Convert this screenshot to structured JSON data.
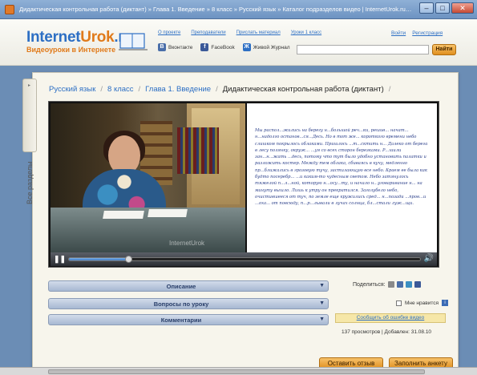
{
  "browser": {
    "title": "Дидактическая контрольная работа (диктант) » Глава 1. Введение » 8 класс » Русский язык » Каталог подразделов видео | InternetUrok.ru - видеоуроки по физике, математике..."
  },
  "header": {
    "logo_main_a": "Internet",
    "logo_main_b": "Urok",
    "logo_main_c": ".ru",
    "logo_sub": "Видеоуроки в Интернете",
    "nav": [
      "О проекте",
      "Преподаватели",
      "Прислать материал",
      "Уроки 1 класс"
    ],
    "social": [
      {
        "label": "Вконтакте",
        "icon": "vk-icon",
        "color": "#4a6ea9"
      },
      {
        "label": "FaceBook",
        "icon": "facebook-icon",
        "color": "#3b5998"
      },
      {
        "label": "Живой Журнал",
        "icon": "livejournal-icon",
        "color": "#2d6fc4"
      }
    ],
    "auth_login": "Войти",
    "auth_register": "Регистрация",
    "search_placeholder": "",
    "search_button": "Найти"
  },
  "sidebar_tab": "Все разделы",
  "breadcrumb": {
    "items": [
      "Русский язык",
      "8 класс",
      "Глава 1. Введение"
    ],
    "current": "Дидактическая контрольная работа (диктант)"
  },
  "video": {
    "watermark": "InternetUrok",
    "progress": 0.17,
    "dictation_text": "Мы распол...жились на берегу н...большой реч...ки, решив... начат... н...надолго останов...ся...Десь. Но в тот же... короткого времени небо слишком покрылось облаками. Пришлось ...т...сктить н... Далеко от берега в лесу полянку, окруж... ...уя со всех сторон березками. Р...шили зан...н...жать ...десь, потому что тут было удобно установить палатки и разложить костер. Между тем облака, сбиваясь в кучу, медленно пр...ближались в грозовую тучу, застилающую все небо. Краем ее была как будто посеребр... ...и каким-то чудесным светом. Небо затянулось тяжелой п...л...ной, которую н...осу...ту, и начало н...уговаривание н... на минуту вышло. Лишь к утру он прекратился. Заголубело небо, очистившееся от туч, по земле еще кружились сред... н...позади ...пров...и ...оха... от повсюду, п...р...лывали в лучах солнца, бл...стали луж...щи."
  },
  "panels": {
    "description": "Описание",
    "questions": "Вопросы по уроку",
    "comments": "Комментарии"
  },
  "share": {
    "label": "Поделиться:",
    "like_label": "Мне нравится",
    "report_label": "Сообщить об ошибке видео",
    "stats": "137 просмотров | Добавлен: 31.08.10"
  },
  "actions": {
    "review": "Оставить отзыв",
    "survey": "Заполнить анкету"
  }
}
